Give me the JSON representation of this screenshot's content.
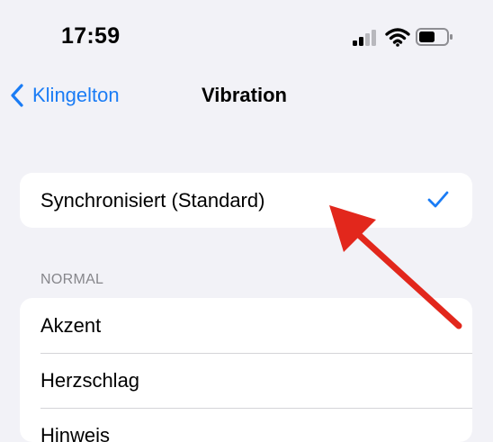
{
  "status_bar": {
    "time": "17:59",
    "icons": [
      "cellular-signal-icon",
      "wifi-icon",
      "battery-icon"
    ]
  },
  "nav": {
    "back_label": "Klingelton",
    "title": "Vibration"
  },
  "sync_option": {
    "label": "Synchronisiert (Standard)",
    "selected": true
  },
  "normal_section": {
    "header": "NORMAL",
    "items": [
      {
        "label": "Akzent"
      },
      {
        "label": "Herzschlag"
      },
      {
        "label": "Hinweis"
      }
    ]
  },
  "colors": {
    "accent": "#1a7cf5",
    "background": "#f2f2f7",
    "annotation_arrow": "#e2271c"
  }
}
